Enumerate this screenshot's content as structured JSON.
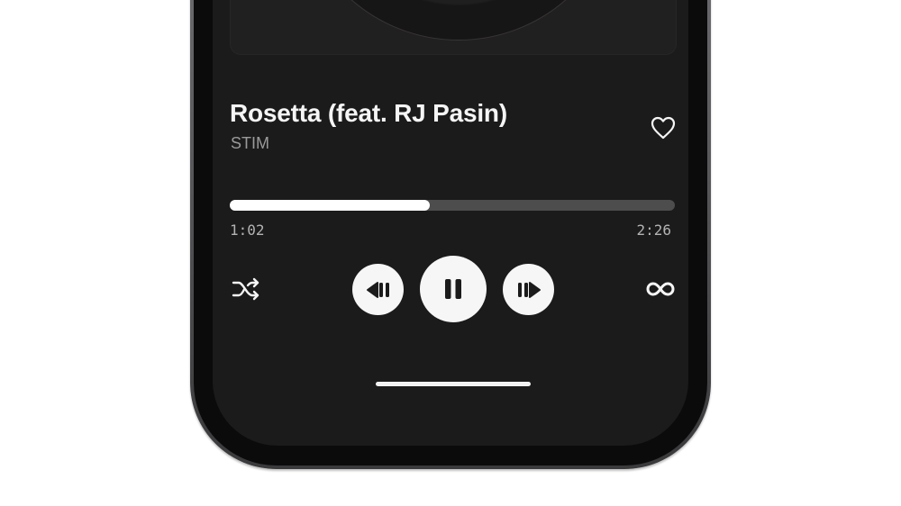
{
  "track": {
    "title": "Rosetta (feat. RJ Pasin)",
    "artist": "STIM",
    "liked": false
  },
  "playback": {
    "elapsed": "1:02",
    "total": "2:26",
    "progress_fraction": 0.45,
    "state": "playing"
  },
  "controls": {
    "shuffle_icon": "shuffle-icon",
    "previous_icon": "skip-back-icon",
    "pause_icon": "pause-icon",
    "next_icon": "skip-forward-icon",
    "repeat_icon": "infinity-icon"
  },
  "colors": {
    "background": "#1b1b1b",
    "progress_fill": "#ffffff",
    "progress_track": "#4d4d4d",
    "needle_accent": "#e04326"
  }
}
